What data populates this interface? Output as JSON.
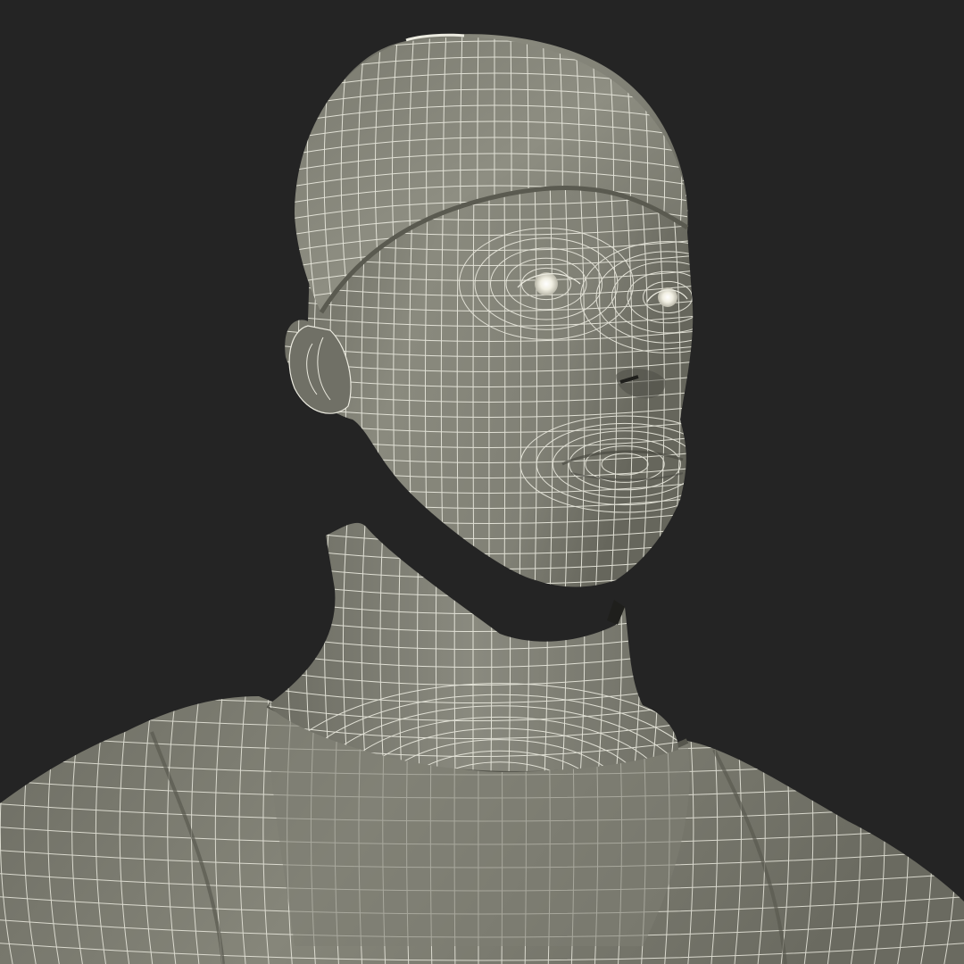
{
  "scene": {
    "subject": "3d-wireframe-bust",
    "shading": "flat-grey-with-wire-overlay",
    "colors": {
      "background": "#242424",
      "surface_light": "#8d8d81",
      "surface_mid": "#76766b",
      "surface_dark": "#55554c",
      "wire": "#ecebe0",
      "eye_glow": "#f4f2e6"
    }
  }
}
